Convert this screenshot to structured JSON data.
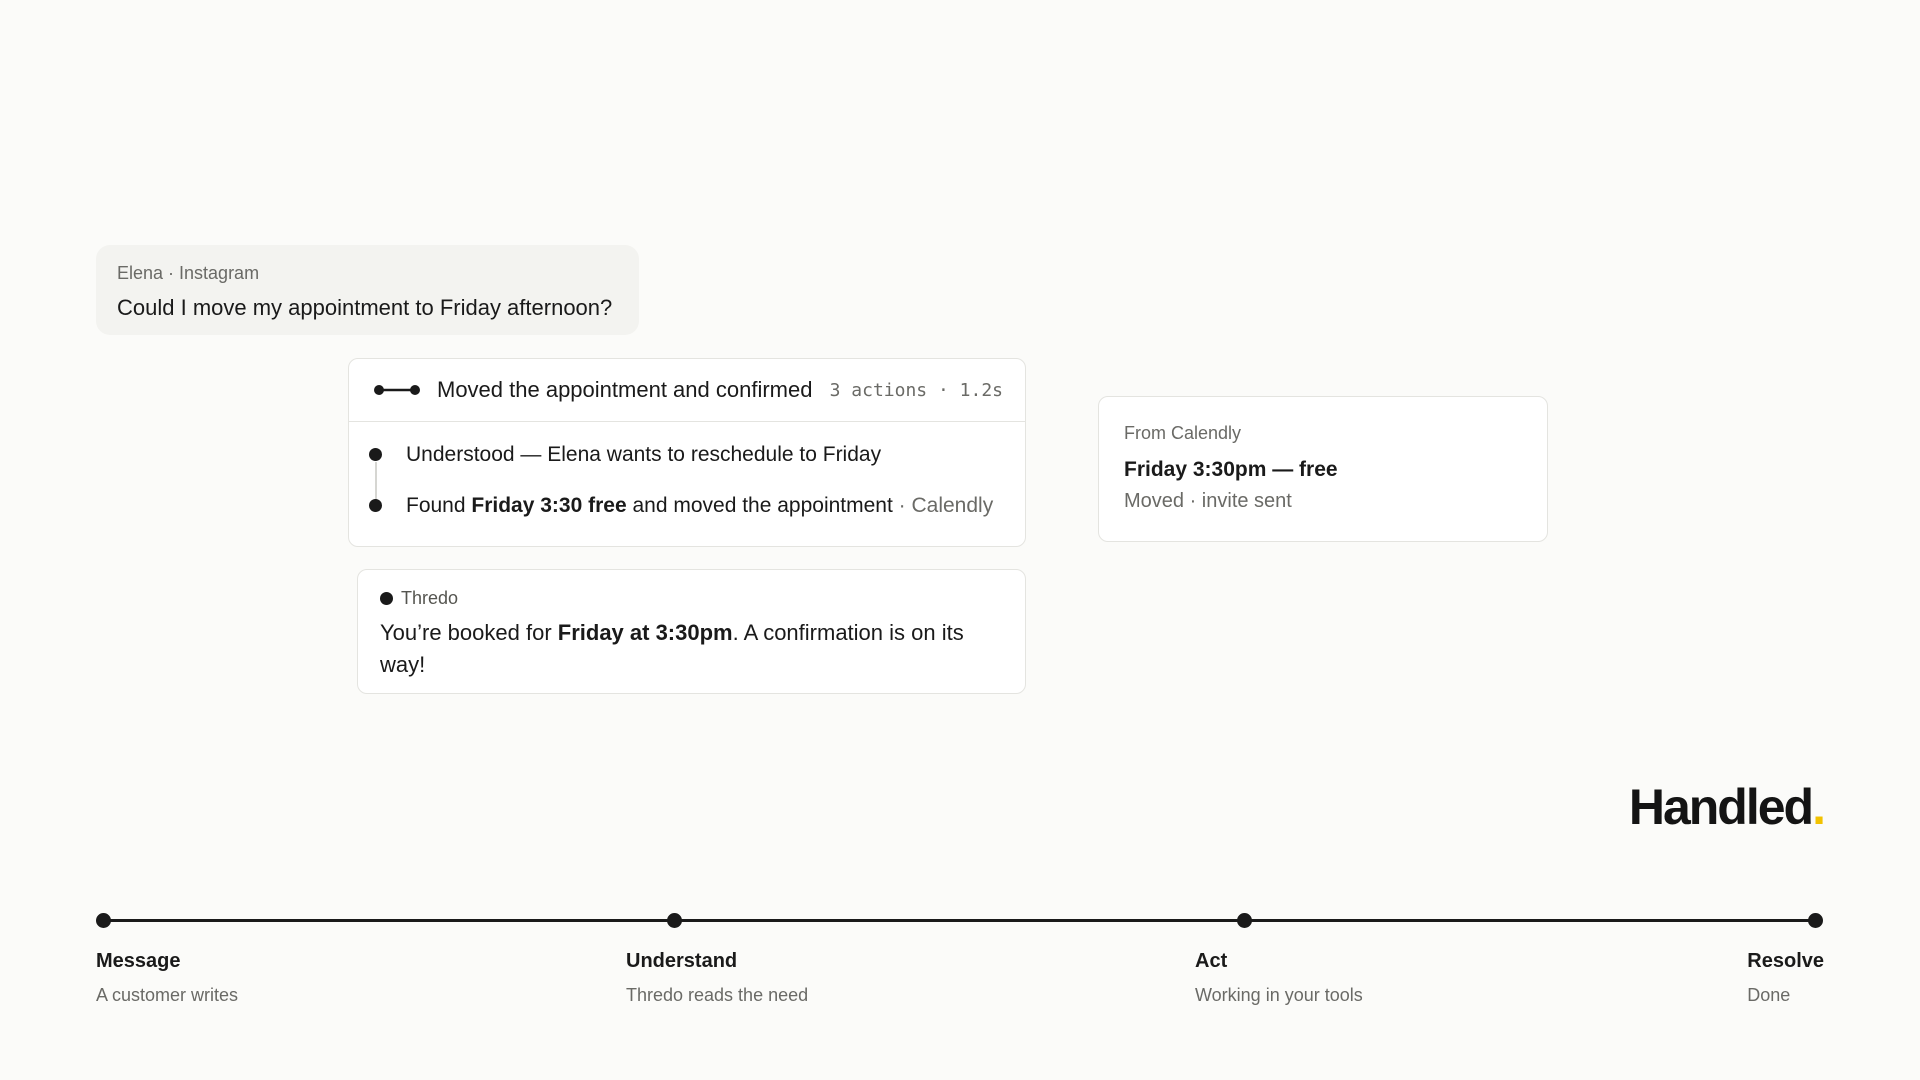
{
  "incoming": {
    "meta": "Elena · Instagram",
    "text": "Could I move my appointment to Friday afternoon?"
  },
  "actions": {
    "summary": "Moved the appointment and confirmed",
    "stats": "3 actions · 1.2s",
    "steps": [
      {
        "text": "Understood — Elena wants to reschedule to Friday"
      },
      {
        "pre": "Found ",
        "bold": "Friday 3:30 free",
        "post": " and moved the appointment",
        "source": " · Calendly"
      }
    ]
  },
  "reply": {
    "sender": "Thredo",
    "pre": "You’re booked for ",
    "bold": "Friday at 3:30pm",
    "post": ". A confirmation is on its way!"
  },
  "calendly": {
    "source": "From Calendly",
    "title": "Friday 3:30pm — free",
    "status": "Moved · invite sent"
  },
  "brand": {
    "name": "Handled",
    "accent": ".",
    "accent_color": "#f2c200"
  },
  "timeline": [
    {
      "name": "Message",
      "desc": "A customer writes"
    },
    {
      "name": "Understand",
      "desc": "Thredo reads the need"
    },
    {
      "name": "Act",
      "desc": "Working in your tools"
    },
    {
      "name": "Resolve",
      "desc": "Done"
    }
  ]
}
